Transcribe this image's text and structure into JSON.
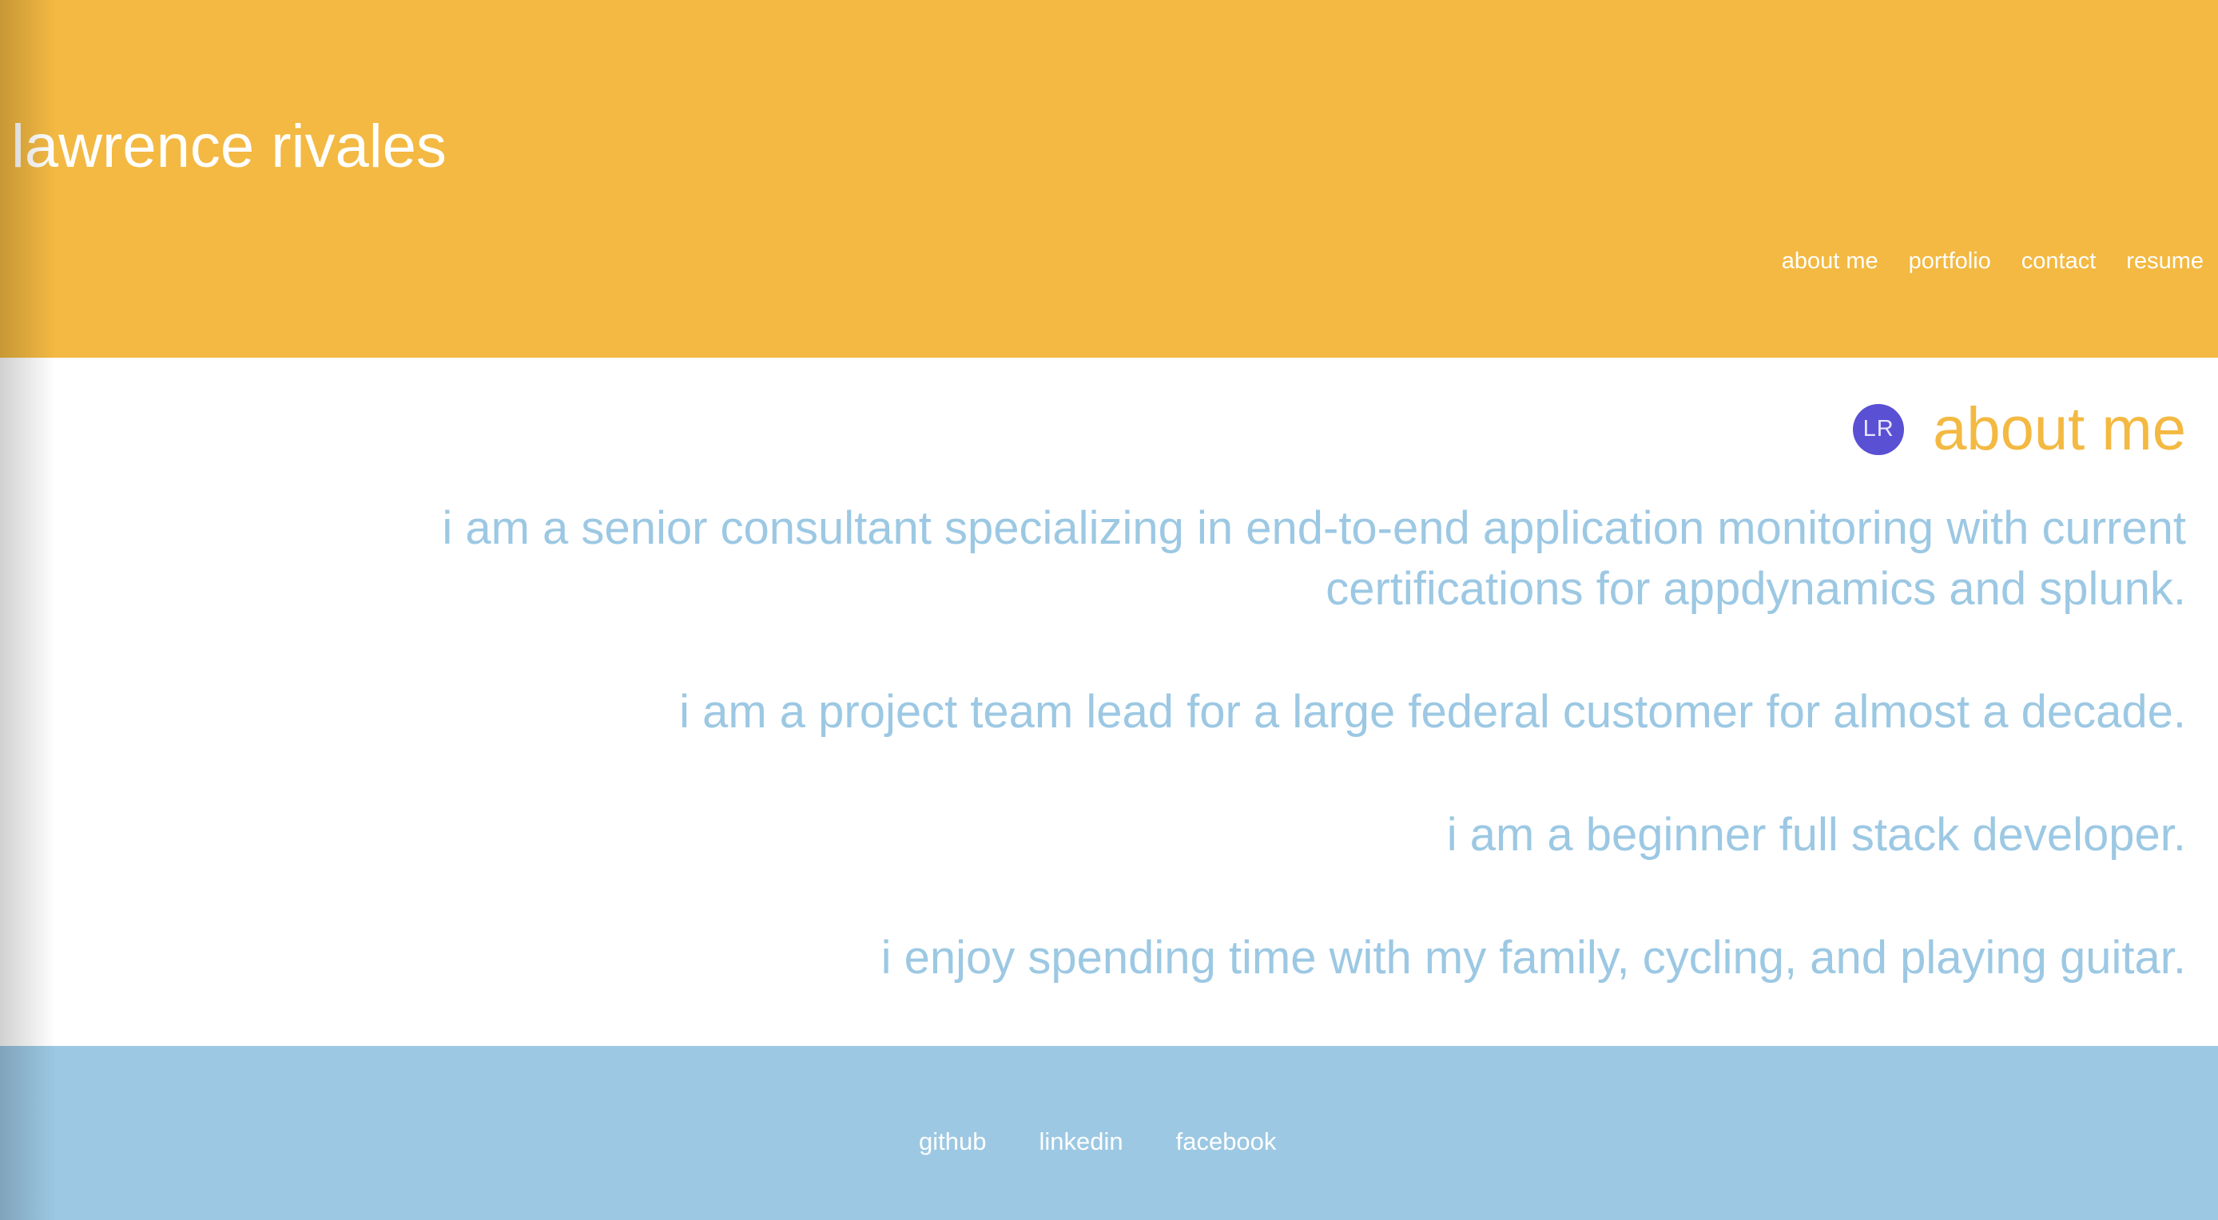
{
  "site": {
    "title": "lawrence rivales"
  },
  "nav": {
    "items": [
      {
        "label": "about me"
      },
      {
        "label": "portfolio"
      },
      {
        "label": "contact"
      },
      {
        "label": "resume"
      }
    ]
  },
  "about": {
    "avatar_initials": "LR",
    "heading": "about me",
    "paragraphs": [
      "i am a senior consultant specializing in end-to-end application monitoring with current certifications for appdynamics and splunk.",
      "i am a project team lead for a large federal customer for almost a decade.",
      "i am a beginner full stack developer.",
      "i enjoy spending time with my family, cycling, and playing guitar."
    ]
  },
  "footer": {
    "links": [
      {
        "label": "github"
      },
      {
        "label": "linkedin"
      },
      {
        "label": "facebook"
      }
    ]
  },
  "colors": {
    "header_bg": "#f3b942",
    "footer_bg": "#9cc8e3",
    "bio_text": "#9cc8e3",
    "heading_text": "#f3b942",
    "avatar_bg": "#5a50d4"
  }
}
